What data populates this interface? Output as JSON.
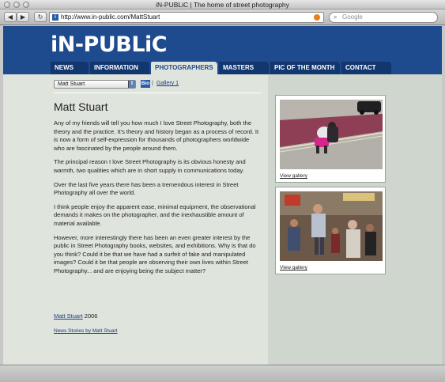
{
  "window": {
    "title": "iN-PUBLiC | The home of street photography",
    "url": "http://www.in-public.com/MattStuart",
    "search_placeholder": "Google"
  },
  "site": {
    "logo": "iN-PUBLiC",
    "nav": [
      {
        "label": "News"
      },
      {
        "label": "Information"
      },
      {
        "label": "Photographers",
        "active": true
      },
      {
        "label": "Masters"
      },
      {
        "label": "Pic of the Month"
      },
      {
        "label": "Contact"
      }
    ]
  },
  "photographer": {
    "select_value": "Matt Stuart",
    "bio_badge": "Bio",
    "separator": "|",
    "gallery_link": "Gallery 1",
    "name": "Matt Stuart",
    "paragraphs": [
      "Any of my friends will tell you how much I love Street Photography, both the theory and the practice. It's theory and history began as a process of record. It is now a form of self-expression for thousands of photographers worldwide who are fascinated by the people around them.",
      "The principal reason I love Street Photography is its obvious honesty and warmth, two qualities which are in short supply in communications today.",
      "Over the last five years there has been a tremendous interest in Street Photography all over the world.",
      "I think people enjoy the apparent ease, minimal equipment, the observational demands it makes on the photographer, and the inexhaustible amount of material available.",
      "However, more interestingly there has been an even greater interest by the public in Street Photography books, websites, and exhibitions. Why is that do you think? Could it be that we have had a surfeit of fake and manipulated images? Could it be that people are observing their own lives within Street Photography... and are enjoying being the subject matter?"
    ],
    "credit_name": "Matt Stuart",
    "credit_year": "2006",
    "news_link": "News Stories by Matt Stuart"
  },
  "sidebar": {
    "cards": [
      {
        "link": "View gallery"
      },
      {
        "link": "View gallery"
      }
    ]
  },
  "colors": {
    "header_blue": "#1e4a8e",
    "nav_dark": "#12366e",
    "page_bg": "#dfe4dc",
    "link": "#1b3d80"
  }
}
